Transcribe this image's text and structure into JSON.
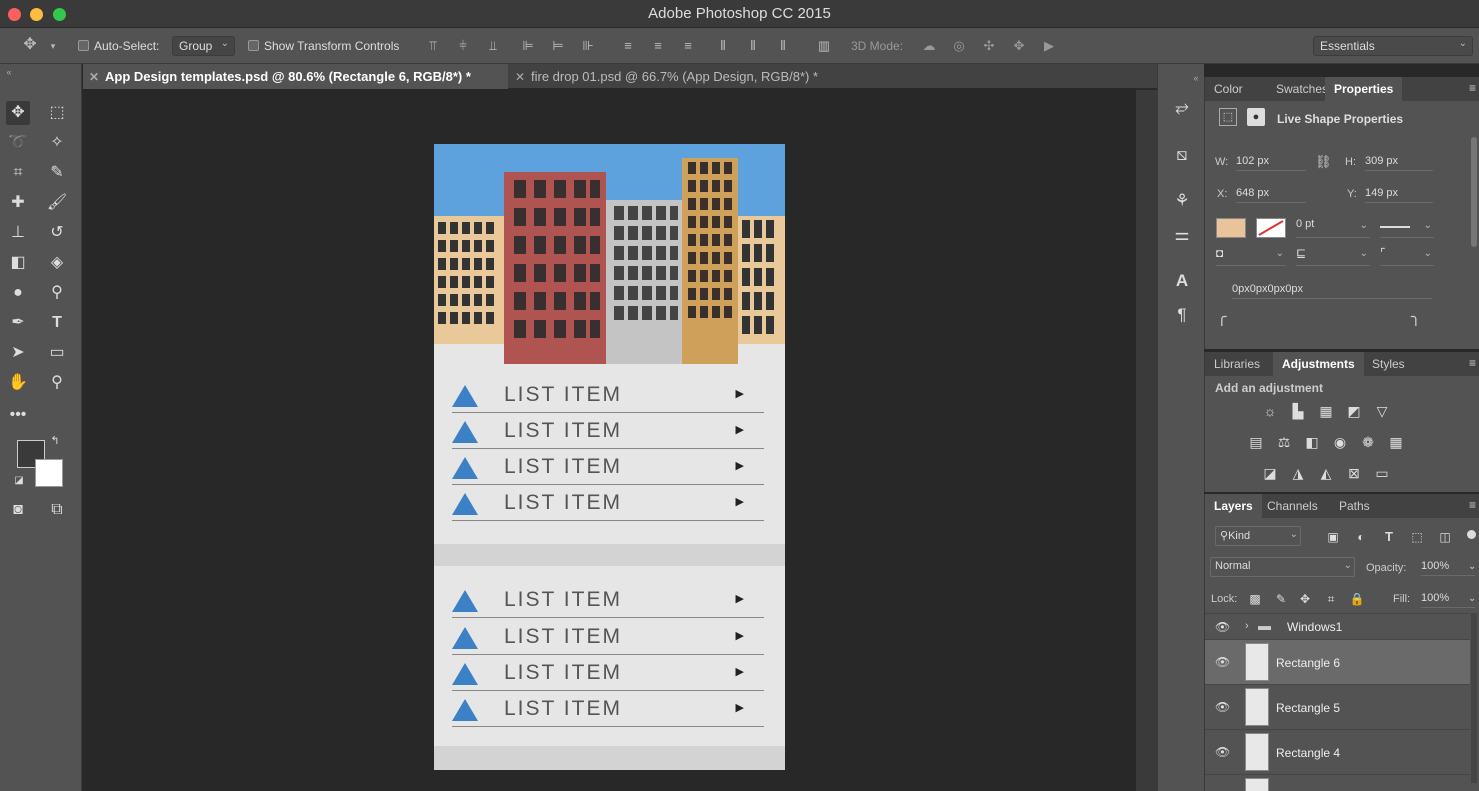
{
  "window": {
    "title": "Adobe Photoshop CC 2015"
  },
  "options_bar": {
    "auto_select_label": "Auto-Select:",
    "auto_select_value": "Group",
    "show_transform_label": "Show Transform Controls",
    "mode_3d_label": "3D Mode:",
    "workspace": "Essentials"
  },
  "tabs": [
    {
      "label": "App Design templates.psd @ 80.6% (Rectangle 6, RGB/8*) *",
      "active": true
    },
    {
      "label": "fire drop 01.psd @ 66.7% (App Design, RGB/8*) *",
      "active": false
    }
  ],
  "document": {
    "list_group_1": [
      "LIST ITEM",
      "LIST ITEM",
      "LIST ITEM",
      "LIST ITEM"
    ],
    "list_group_2": [
      "LIST ITEM",
      "LIST ITEM",
      "LIST ITEM",
      "LIST ITEM"
    ],
    "colors": {
      "sky": "#5da2dc",
      "red_building": "#b05452",
      "gray_building": "#c4c4c4",
      "gold_building": "#cfa05a",
      "beige_building": "#e9c89a",
      "triangle": "#3c80c6"
    }
  },
  "properties_panel": {
    "tabs": [
      "Color",
      "Swatches",
      "Properties"
    ],
    "active_tab": "Properties",
    "section_title": "Live Shape Properties",
    "w_label": "W:",
    "w_value": "102 px",
    "h_label": "H:",
    "h_value": "309 px",
    "x_label": "X:",
    "x_value": "648 px",
    "y_label": "Y:",
    "y_value": "149 px",
    "fill_color": "#e9c49a",
    "stroke_width": "0 pt",
    "corner_radii": "0px0px0px0px"
  },
  "adjustments_panel": {
    "tabs": [
      "Libraries",
      "Adjustments",
      "Styles"
    ],
    "active_tab": "Adjustments",
    "heading": "Add an adjustment"
  },
  "layers_panel": {
    "tabs": [
      "Layers",
      "Channels",
      "Paths"
    ],
    "active_tab": "Layers",
    "filter_kind": "Kind",
    "blend_mode": "Normal",
    "opacity_label": "Opacity:",
    "opacity_value": "100%",
    "lock_label": "Lock:",
    "fill_label": "Fill:",
    "fill_value": "100%",
    "layers": [
      {
        "name": "Windows1",
        "type": "group",
        "selected": false
      },
      {
        "name": "Rectangle 6",
        "type": "shape",
        "selected": true
      },
      {
        "name": "Rectangle 5",
        "type": "shape",
        "selected": false
      },
      {
        "name": "Rectangle 4",
        "type": "shape",
        "selected": false
      }
    ]
  }
}
